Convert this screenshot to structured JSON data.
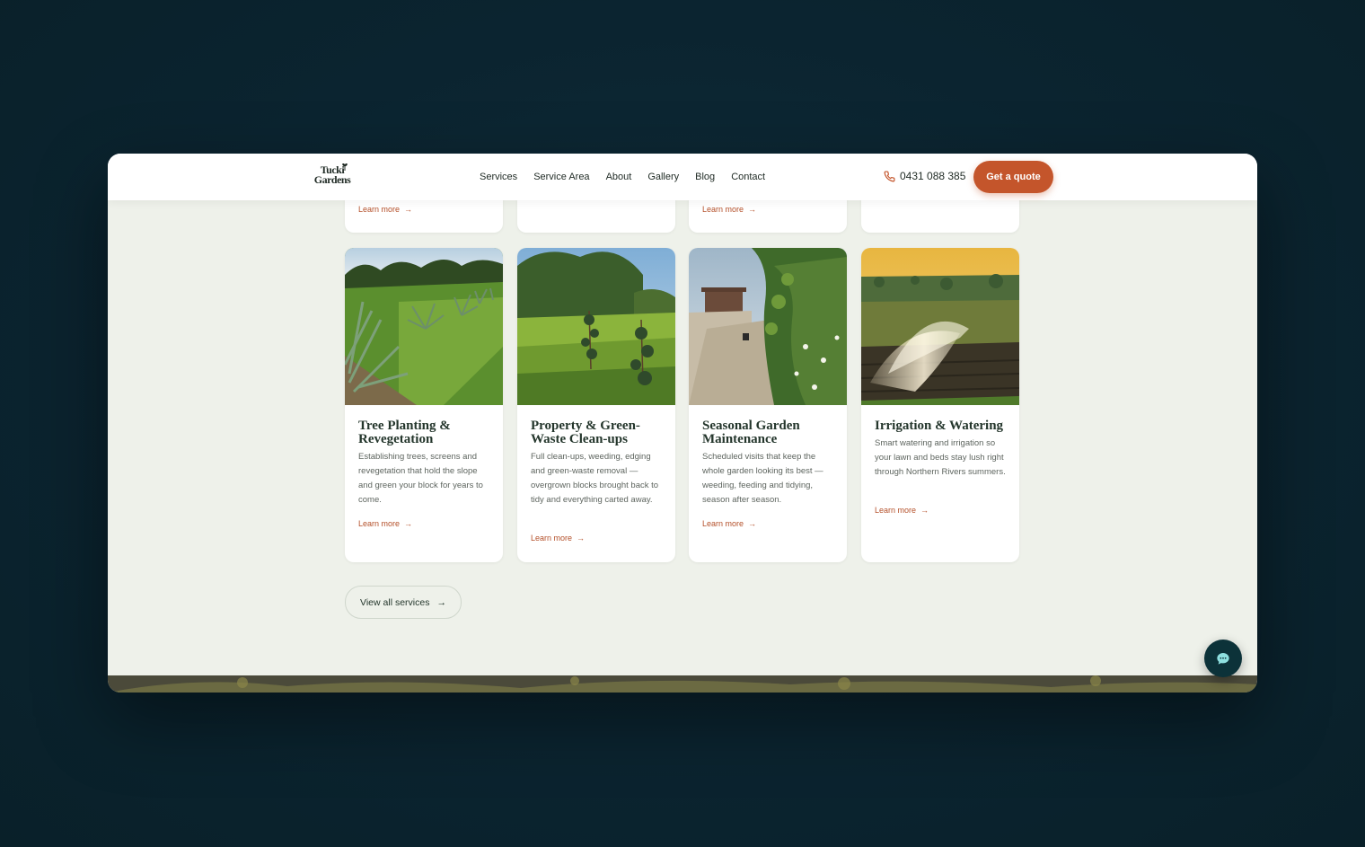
{
  "brand": {
    "logo_line1": "Tucki",
    "logo_line2": "Gardens"
  },
  "nav": [
    "Services",
    "Service Area",
    "About",
    "Gallery",
    "Blog",
    "Contact"
  ],
  "phone": {
    "number": "0431 088 385",
    "icon": "phone-icon"
  },
  "cta": {
    "label": "Get a quote"
  },
  "prev_cards": [
    {
      "learn_more": "Learn more"
    },
    {
      "learn_more": ""
    },
    {
      "learn_more": "Learn more"
    },
    {
      "learn_more": ""
    }
  ],
  "services": [
    {
      "title_line1": "Tree Planting &",
      "title_line2": "Revegetation",
      "description": "Establishing trees, screens and revegetation that hold the slope and green your block for years to come.",
      "learn_more": "Learn more"
    },
    {
      "title_line1": "Property & Green-",
      "title_line2": "Waste Clean-ups",
      "description": "Full clean-ups, weeding, edging and green-waste removal — overgrown blocks brought back to tidy and everything carted away.",
      "learn_more": "Learn more"
    },
    {
      "title_line1": "Seasonal Garden",
      "title_line2": "Maintenance",
      "description": "Scheduled visits that keep the whole garden looking its best — weeding, feeding and tidying, season after season.",
      "learn_more": "Learn more"
    },
    {
      "title_line1": "Irrigation & Watering",
      "title_line2": "",
      "description": "Smart watering and irrigation so your lawn and beds stay lush right through Northern Rivers summers.",
      "learn_more": "Learn more"
    }
  ],
  "view_all": {
    "label": "View all services"
  },
  "chat": {
    "icon": "chat-bubble-icon"
  },
  "colors": {
    "accent": "#c4552b",
    "dark": "#0c3239",
    "page_bg": "#eef1ea"
  }
}
